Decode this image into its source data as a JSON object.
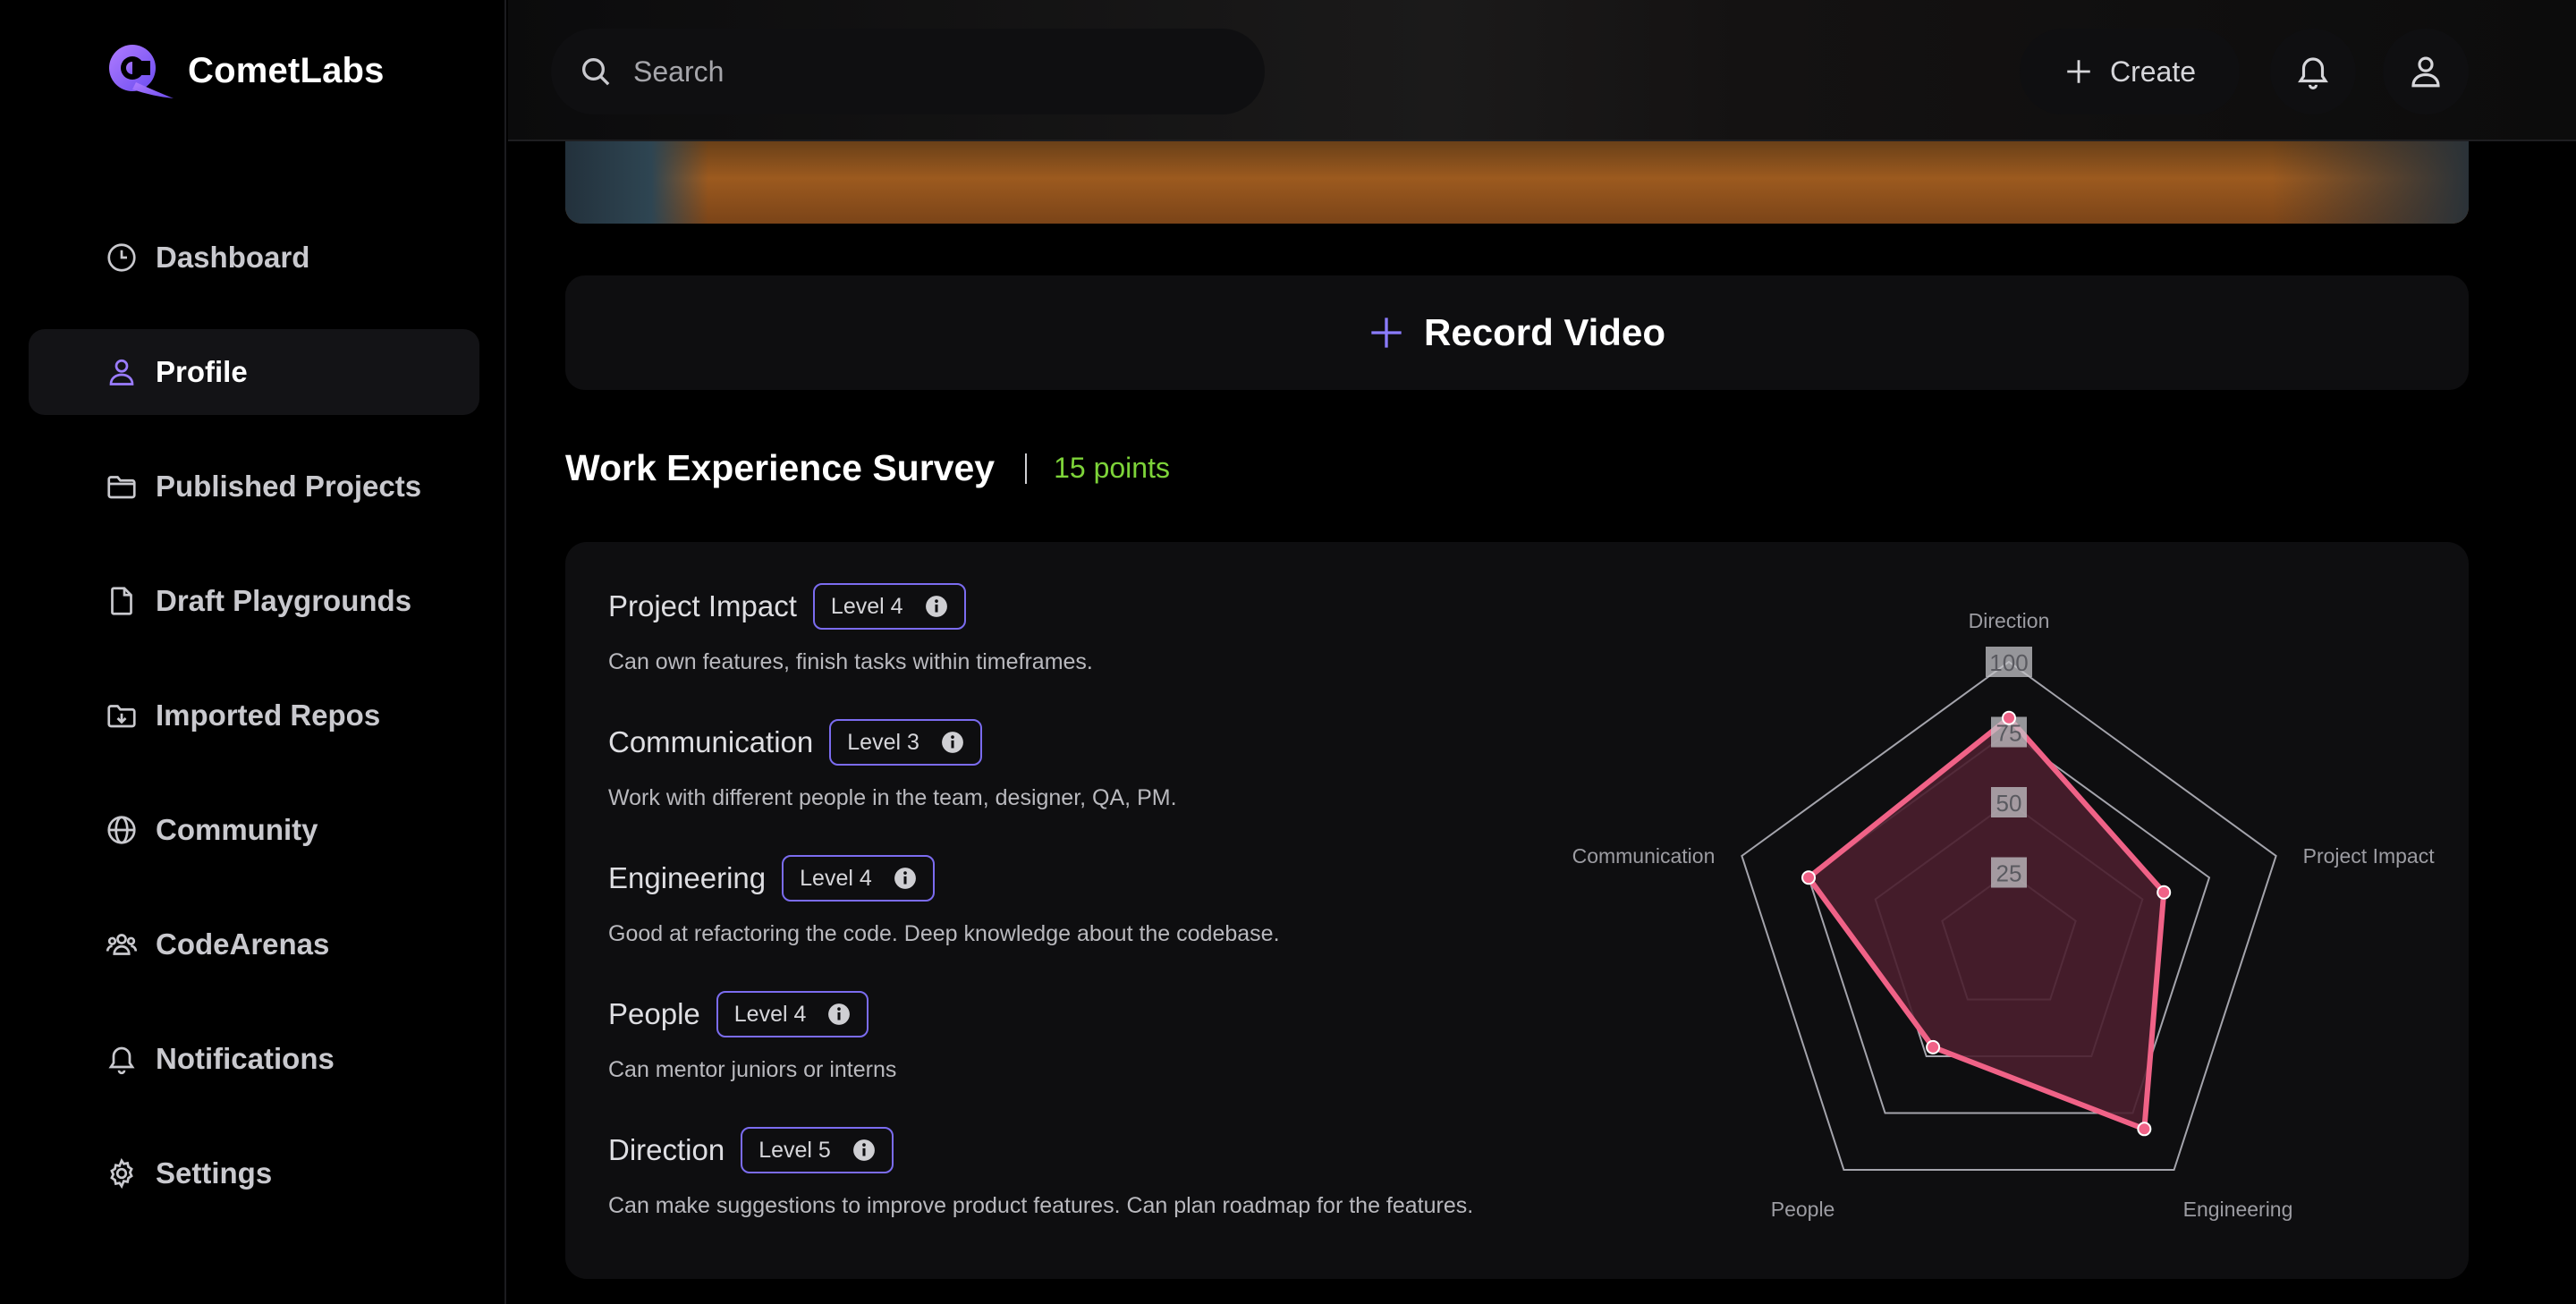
{
  "app": {
    "name": "CometLabs"
  },
  "sidebar": {
    "items": [
      {
        "label": "Dashboard",
        "icon": "clock-icon"
      },
      {
        "label": "Profile",
        "icon": "user-icon",
        "active": true
      },
      {
        "label": "Published Projects",
        "icon": "folder-icon"
      },
      {
        "label": "Draft Playgrounds",
        "icon": "file-icon"
      },
      {
        "label": "Imported Repos",
        "icon": "folder-download-icon"
      },
      {
        "label": "Community",
        "icon": "globe-icon"
      },
      {
        "label": "CodeArenas",
        "icon": "users-icon"
      },
      {
        "label": "Notifications",
        "icon": "bell-icon"
      },
      {
        "label": "Settings",
        "icon": "gear-icon"
      }
    ]
  },
  "topbar": {
    "search_placeholder": "Search",
    "create_label": "Create"
  },
  "main": {
    "record_label": "Record Video",
    "survey": {
      "title": "Work Experience Survey",
      "points": "15 points",
      "skills": [
        {
          "name": "Project Impact",
          "level": "Level 4",
          "desc": "Can own features, finish tasks within timeframes."
        },
        {
          "name": "Communication",
          "level": "Level 3",
          "desc": "Work with different people in the team, designer, QA, PM."
        },
        {
          "name": "Engineering",
          "level": "Level 4",
          "desc": "Good at refactoring the code. Deep knowledge about the codebase."
        },
        {
          "name": "People",
          "level": "Level 4",
          "desc": "Can mentor juniors or interns"
        },
        {
          "name": "Direction",
          "level": "Level 5",
          "desc": "Can make suggestions to improve product features. Can plan roadmap for the features."
        }
      ]
    }
  },
  "chart_data": {
    "type": "radar",
    "axes": [
      "Direction",
      "Project Impact",
      "Engineering",
      "People",
      "Communication"
    ],
    "values": [
      80,
      58,
      82,
      46,
      75
    ],
    "range": [
      0,
      100
    ],
    "ticks": [
      "25",
      "50",
      "75",
      "100"
    ],
    "series_color": "#f06287",
    "fill_color": "#4a1e2e",
    "grid_color": "#a4a4ac"
  },
  "colors": {
    "accent": "#7b6cf0",
    "points": "#7dd339",
    "background": "#000000",
    "card": "#0e0e10"
  }
}
